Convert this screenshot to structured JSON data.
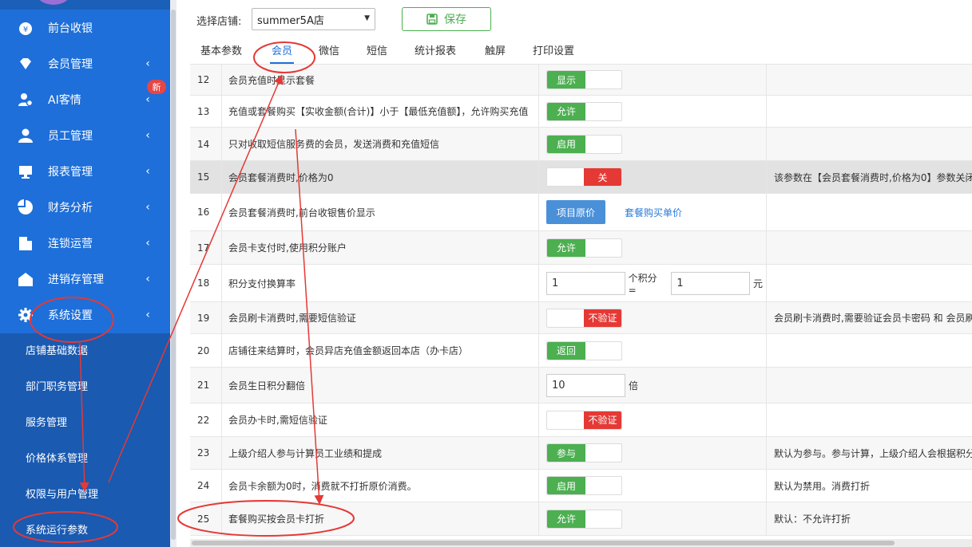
{
  "sidebar": {
    "menu": [
      {
        "label": "前台收银",
        "icon": "yen-coin-icon",
        "has_chevron": false
      },
      {
        "label": "会员管理",
        "icon": "diamond-icon",
        "has_chevron": true
      },
      {
        "label": "AI客情",
        "icon": "user-settings-icon",
        "has_chevron": true,
        "badge": "新"
      },
      {
        "label": "员工管理",
        "icon": "user-icon",
        "has_chevron": true
      },
      {
        "label": "报表管理",
        "icon": "monitor-icon",
        "has_chevron": true
      },
      {
        "label": "财务分析",
        "icon": "pie-chart-icon",
        "has_chevron": true
      },
      {
        "label": "连锁运营",
        "icon": "building-icon",
        "has_chevron": true
      },
      {
        "label": "进销存管理",
        "icon": "warehouse-icon",
        "has_chevron": true
      },
      {
        "label": "系统设置",
        "icon": "gear-icon",
        "has_chevron": true
      }
    ],
    "submenu": [
      {
        "label": "店铺基础数据"
      },
      {
        "label": "部门职务管理"
      },
      {
        "label": "服务管理"
      },
      {
        "label": "价格体系管理"
      },
      {
        "label": "权限与用户管理"
      },
      {
        "label": "系统运行参数"
      }
    ],
    "chevron": "‹"
  },
  "toolbar": {
    "store_label": "选择店铺:",
    "store_value": "summer5A店",
    "save_label": "保存"
  },
  "tabs": [
    {
      "label": "基本参数"
    },
    {
      "label": "会员",
      "active": true
    },
    {
      "label": "微信"
    },
    {
      "label": "短信"
    },
    {
      "label": "统计报表"
    },
    {
      "label": "触屏"
    },
    {
      "label": "打印设置"
    }
  ],
  "rows": [
    {
      "num": "12",
      "name": "会员充值时显示套餐",
      "control": {
        "type": "toggle-on",
        "label": "显示"
      },
      "note": ""
    },
    {
      "num": "13",
      "name": "充值或套餐购买【实收金额(合计)】小于【最低充值额】，允许购买充值",
      "control": {
        "type": "toggle-on",
        "label": "允许"
      },
      "note": ""
    },
    {
      "num": "14",
      "name": "只对收取短信服务费的会员，发送消费和充值短信",
      "control": {
        "type": "toggle-on",
        "label": "启用"
      },
      "note": ""
    },
    {
      "num": "15",
      "name": "会员套餐消费时,价格为0",
      "control": {
        "type": "toggle-off",
        "label": "关"
      },
      "note": "该参数在【会员套餐消费时,价格为0】参数关闭"
    },
    {
      "num": "16",
      "name": "会员套餐消费时,前台收银售价显示",
      "control": {
        "type": "button-link",
        "button": "项目原价",
        "link": "套餐购买单价"
      },
      "note": ""
    },
    {
      "num": "17",
      "name": "会员卡支付时,使用积分账户",
      "control": {
        "type": "toggle-on",
        "label": "允许"
      },
      "note": ""
    },
    {
      "num": "18",
      "name": "积分支付换算率",
      "control": {
        "type": "ratio",
        "value1": "1",
        "mid": "个积分 =",
        "value2": "1",
        "unit": "元"
      },
      "note": ""
    },
    {
      "num": "19",
      "name": "会员刷卡消费时,需要短信验证",
      "control": {
        "type": "toggle-off",
        "label": "不验证"
      },
      "note": "会员刷卡消费时,需要验证会员卡密码 和 会员刷"
    },
    {
      "num": "20",
      "name": "店铺往来结算时，会员异店充值金额返回本店（办卡店）",
      "control": {
        "type": "toggle-on",
        "label": "返回"
      },
      "note": ""
    },
    {
      "num": "21",
      "name": "会员生日积分翻倍",
      "control": {
        "type": "input-unit",
        "value": "10",
        "unit": "倍"
      },
      "note": ""
    },
    {
      "num": "22",
      "name": "会员办卡时,需短信验证",
      "control": {
        "type": "toggle-off",
        "label": "不验证"
      },
      "note": ""
    },
    {
      "num": "23",
      "name": "上级介绍人参与计算员工业绩和提成",
      "control": {
        "type": "toggle-on",
        "label": "参与"
      },
      "note": "默认为参与。参与计算，上级介绍人会根据积分"
    },
    {
      "num": "24",
      "name": "会员卡余额为0时，消费就不打折原价消费。",
      "control": {
        "type": "toggle-on",
        "label": "启用"
      },
      "note": "默认为禁用。消费打折"
    },
    {
      "num": "25",
      "name": "套餐购买按会员卡打折",
      "control": {
        "type": "toggle-on",
        "label": "允许"
      },
      "note": "默认：不允许打折"
    }
  ],
  "colors": {
    "sidebar": "#1e6fd9",
    "submenu": "#1a5ab1",
    "toggle_on": "#4caf50",
    "toggle_off": "#e53935",
    "accent": "#1e6fd9",
    "annotation": "#e53935"
  }
}
